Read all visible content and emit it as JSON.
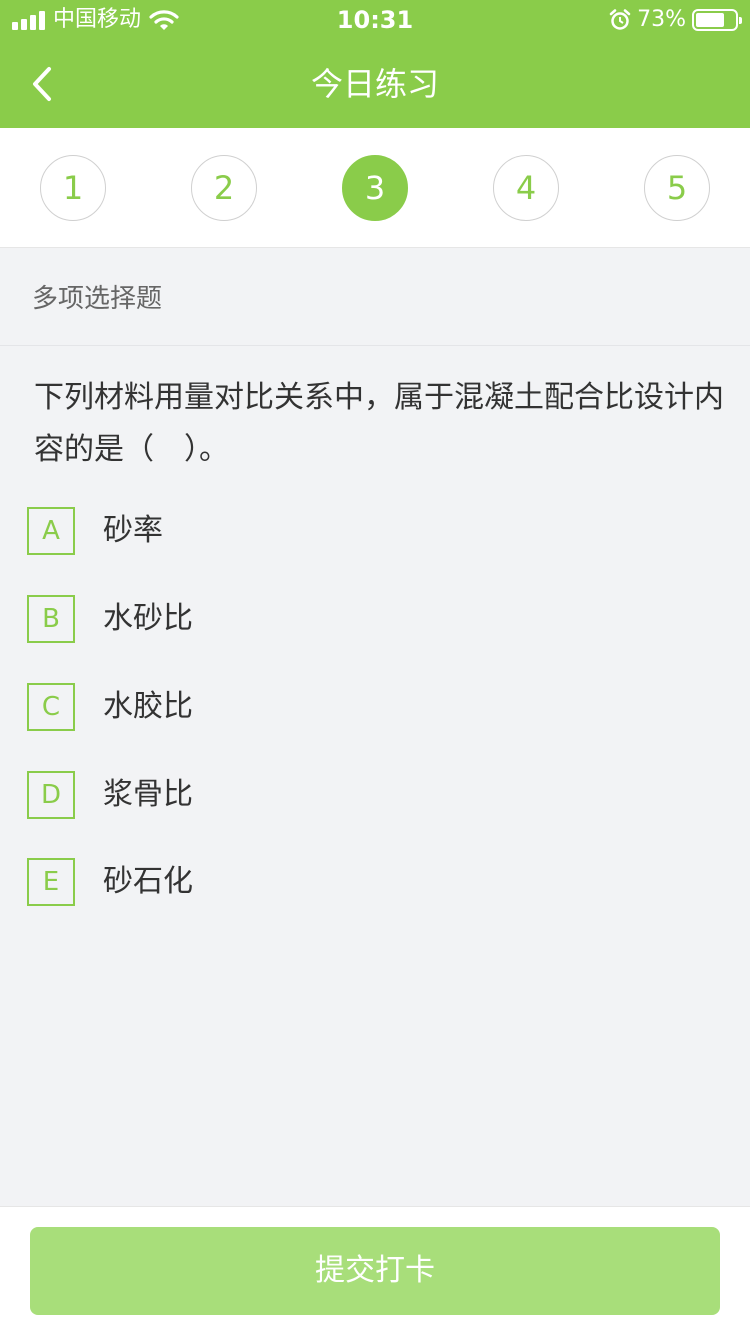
{
  "status_bar": {
    "carrier": "中国移动",
    "time": "10:31",
    "battery_percent": "73%",
    "battery_level": 0.73,
    "icons": [
      "signal-icon",
      "wifi-icon",
      "alarm-icon",
      "battery-icon"
    ]
  },
  "nav": {
    "title": "今日练习",
    "back_icon": "chevron-left-icon"
  },
  "question_numbers": {
    "items": [
      "1",
      "2",
      "3",
      "4",
      "5"
    ],
    "active": "3"
  },
  "question": {
    "type": "多项选择题",
    "stem": "下列材料用量对比关系中，属于混凝土配合比设计内容的是（　）。",
    "options": [
      {
        "key": "A",
        "text": "砂率"
      },
      {
        "key": "B",
        "text": "水砂比"
      },
      {
        "key": "C",
        "text": "水胶比"
      },
      {
        "key": "D",
        "text": "浆骨比"
      },
      {
        "key": "E",
        "text": "砂石化"
      }
    ]
  },
  "footer": {
    "submit_label": "提交打卡"
  },
  "colors": {
    "brand_green": "#8acc4a",
    "submit_disabled": "#a8de7a",
    "background": "#f2f3f5"
  }
}
